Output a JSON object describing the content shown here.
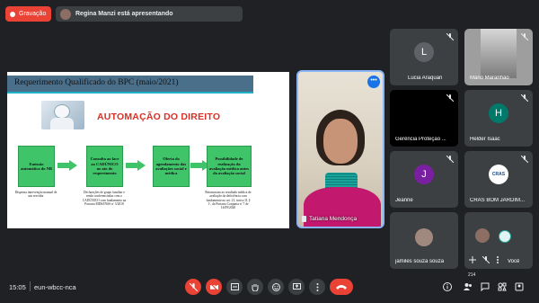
{
  "top": {
    "recording_label": "Gravação",
    "presenting_text": "Regina Manzi está apresentando"
  },
  "slide": {
    "title": "Requerimento Qualificado do BPC (maio/2021)",
    "headline": "AUTOMAÇÃO DO DIREITO",
    "steps": [
      {
        "box": "Emissão automática do NB",
        "desc": "Dispensa intervenção manual de um servidor"
      },
      {
        "box": "Consulta ao face ao CADÚNICO no ato do requerimento",
        "desc": "Declarações de grupo familiar e renda conferenciadas com o CADÚNICO com fundamento na Portaria MDS/INSS nº 3/2018"
      },
      {
        "box": "Oferta do agendamento das avaliações social e médica",
        "desc": ""
      },
      {
        "box": "Possibilidade de realização da avaliação médica antes da avaliação social",
        "desc": "Retomavam ao resultado médica de avaliação da deficiência com fundamento no art. 21, inciso II, § 1º, da Portaria Conjunta nº 7 de 14/09/2020"
      }
    ]
  },
  "speaker": {
    "name": "Tatiana Mendonça",
    "more_label": "•••"
  },
  "tiles": [
    {
      "name": "Lucia Araquan",
      "avatar": "L",
      "color": "#5f6368"
    },
    {
      "name": "Mano Maranhao",
      "avatar": "",
      "color": ""
    },
    {
      "name": "Gerência Proteção ...",
      "avatar": "",
      "color": ""
    },
    {
      "name": "Helder Isaac",
      "avatar": "H",
      "color": "#00796b"
    },
    {
      "name": "Jeanne",
      "avatar": "J",
      "color": "#7b1fa2"
    },
    {
      "name": "CRAS BOM JARDIM...",
      "avatar": "CRAS",
      "color": "#ffffff"
    },
    {
      "name": "jamiles souza souza",
      "avatar": "",
      "color": ""
    },
    {
      "name": "Você",
      "avatar": "",
      "color": ""
    }
  ],
  "bottom": {
    "time": "15:05",
    "meeting_code": "eun-wbcc-nca",
    "people_count": "214"
  },
  "colors": {
    "accent_red": "#ea4335",
    "bar_bg": "#3c4043",
    "flow_green": "#3fc46a"
  }
}
